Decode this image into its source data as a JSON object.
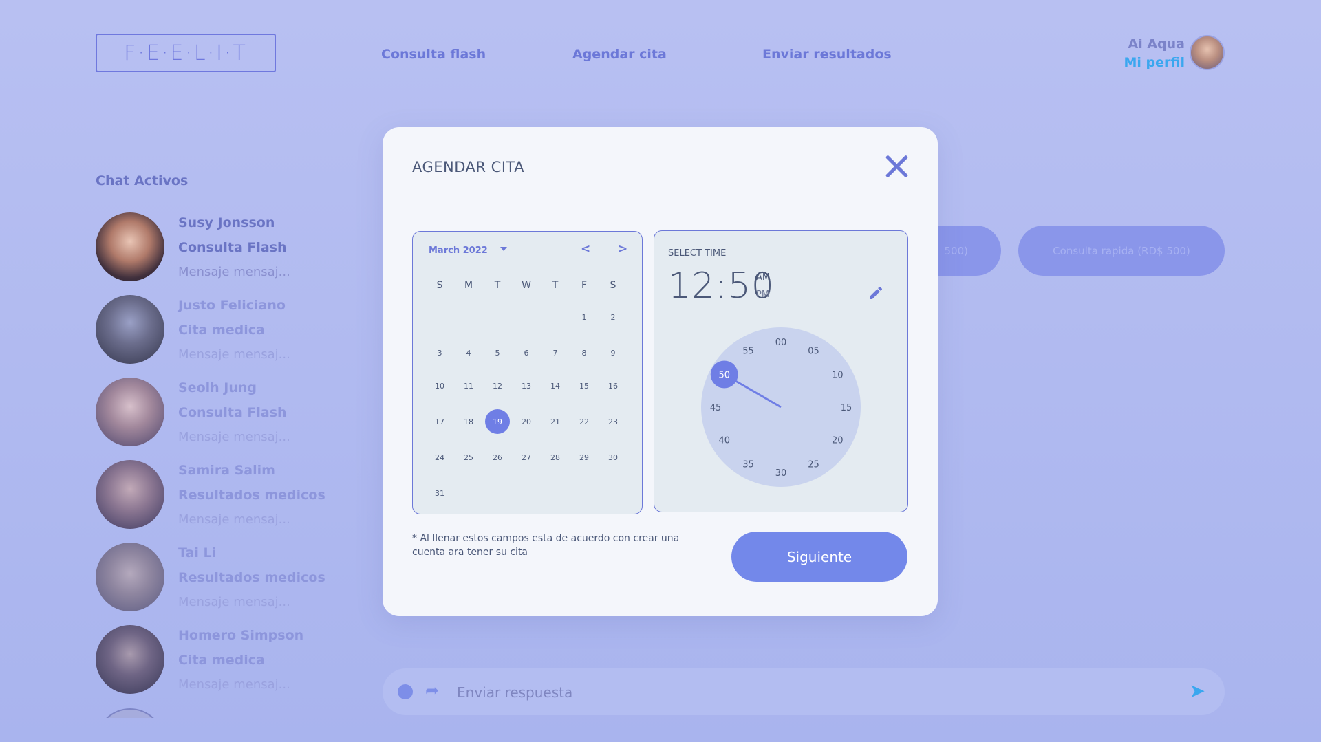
{
  "header": {
    "logo": "F·E·E·L·I·T",
    "nav": [
      "Consulta flash",
      "Agendar cita",
      "Enviar resultados"
    ],
    "user_name": "Ai Aqua",
    "profile_link": "Mi perfil"
  },
  "chats": {
    "title": "Chat Activos",
    "items": [
      {
        "name": "Susy Jonsson",
        "type": "Consulta Flash",
        "message": "Mensaje mensaj..."
      },
      {
        "name": "Justo Feliciano",
        "type": "Cita medica",
        "message": "Mensaje mensaj..."
      },
      {
        "name": "Seolh Jung",
        "type": "Consulta Flash",
        "message": "Mensaje mensaj..."
      },
      {
        "name": "Samira Salim",
        "type": "Resultados medicos",
        "message": "Mensaje mensaj..."
      },
      {
        "name": "Tai Li",
        "type": "Resultados medicos",
        "message": "Mensaje mensaj..."
      },
      {
        "name": "Homero Simpson",
        "type": "Cita medica",
        "message": "Mensaje mensaj..."
      }
    ]
  },
  "pills": [
    "500)",
    "Consulta rapida (RD$ 500)"
  ],
  "reply": {
    "placeholder": "Enviar respuesta"
  },
  "modal": {
    "title": "AGENDAR CITA",
    "calendar": {
      "month_label": "March 2022",
      "weekdays": [
        "S",
        "M",
        "T",
        "W",
        "T",
        "F",
        "S"
      ],
      "first_weekday": 5,
      "days_in_month": 31,
      "selected_day": 19
    },
    "time": {
      "label": "SELECT TIME",
      "value": "12:50",
      "am": "AM",
      "pm": "PM",
      "selected_minute": 50,
      "dial_labels": [
        "00",
        "05",
        "10",
        "15",
        "20",
        "25",
        "30",
        "35",
        "40",
        "45",
        "50",
        "55"
      ]
    },
    "note": "* Al llenar estos campos esta de acuerdo con crear una cuenta ara tener su cita",
    "next_button": "Siguiente"
  },
  "colors": {
    "accent": "#6f7ee5",
    "link_blue": "#3aa7ef",
    "text_dark": "#4b5878"
  }
}
